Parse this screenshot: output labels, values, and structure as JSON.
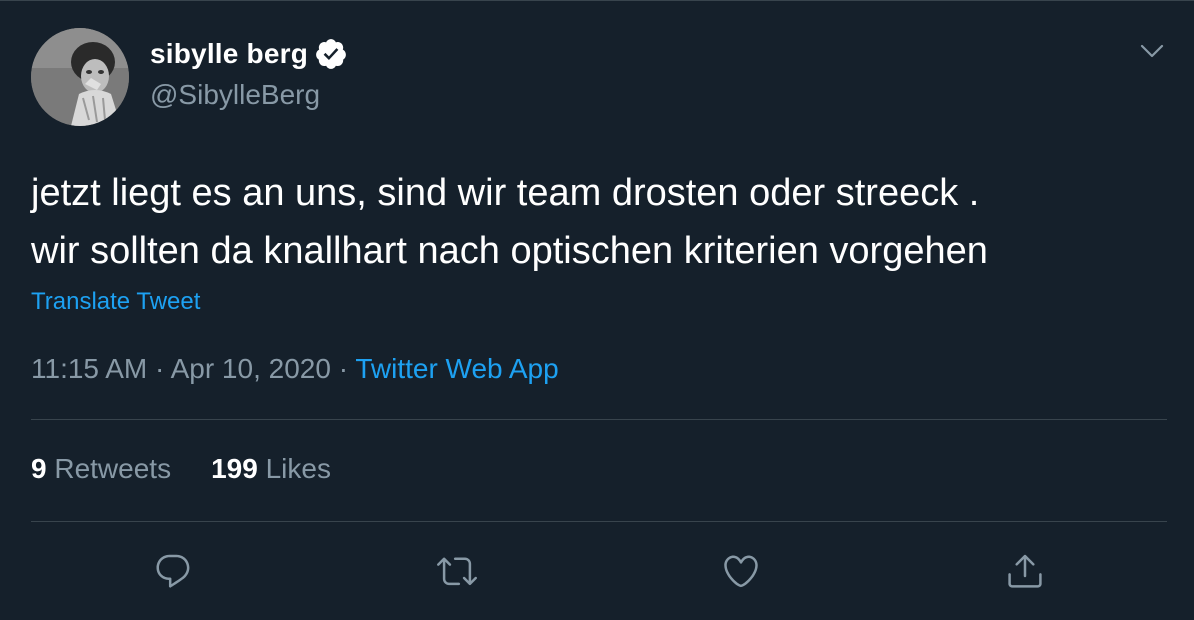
{
  "author": {
    "display_name": "sibylle berg",
    "handle": "@SibylleBerg",
    "verified": true
  },
  "tweet": {
    "lines": [
      "jetzt liegt es an uns, sind wir team drosten oder streeck .",
      "wir sollten da knallhart nach optischen kriterien vorgehen"
    ],
    "translate_label": "Translate Tweet",
    "time": "11:15 AM",
    "date": "Apr 10, 2020",
    "separator": "·",
    "source": "Twitter Web App"
  },
  "stats": {
    "retweets_count": "9",
    "retweets_label": "Retweets",
    "likes_count": "199",
    "likes_label": "Likes"
  },
  "icons": {
    "verified": "verified-badge-icon",
    "more": "chevron-down-icon",
    "reply": "reply-icon",
    "retweet": "retweet-icon",
    "like": "heart-icon",
    "share": "share-icon"
  },
  "colors": {
    "background": "#15202b",
    "accent": "#1da1f2",
    "secondary_text": "#8899a6",
    "divider": "#38444d"
  }
}
